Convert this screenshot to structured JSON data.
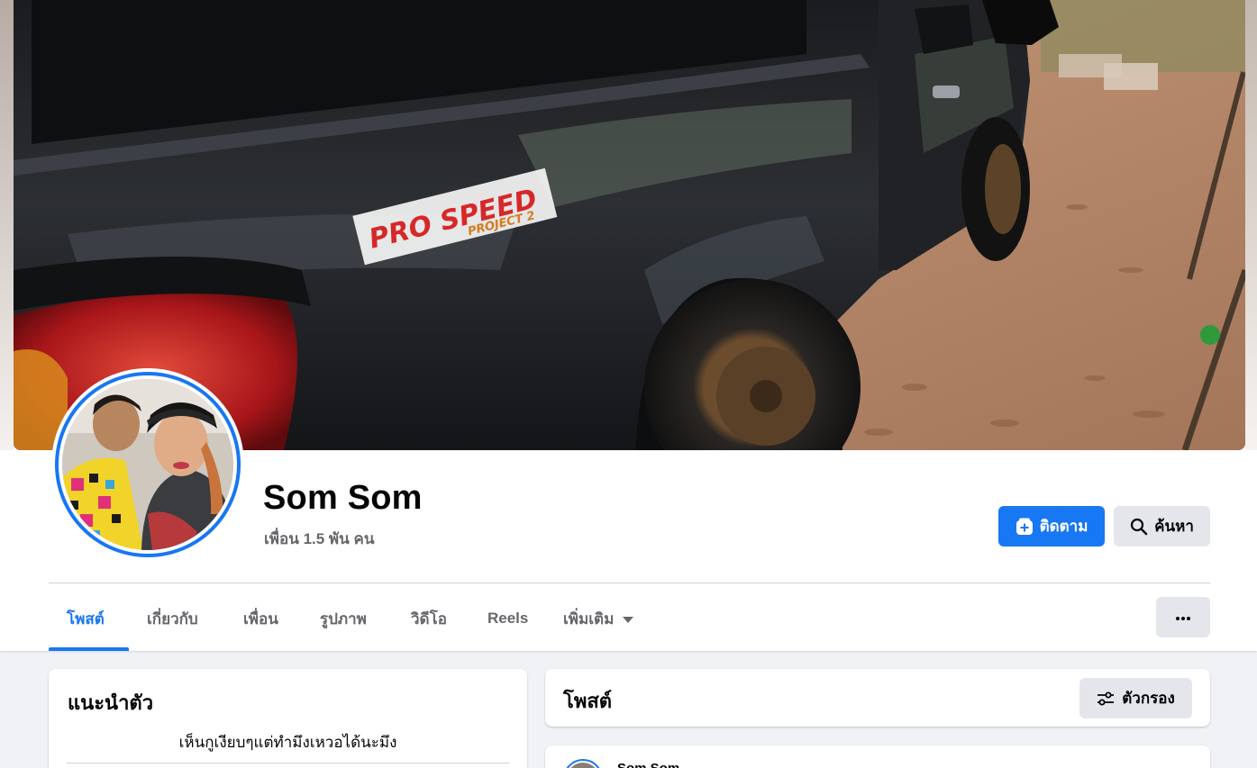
{
  "profile": {
    "name": "Som Som",
    "friends_text": "เพื่อน 1.5 พัน คน"
  },
  "cover": {
    "sticker_text": "PRO SPEED",
    "sticker_subtext": "PROJECT 2"
  },
  "actions": {
    "follow_label": "ติดตาม",
    "search_label": "ค้นหา"
  },
  "tabs": [
    {
      "label": "โพสต์",
      "active": true
    },
    {
      "label": "เกี่ยวกับ",
      "active": false
    },
    {
      "label": "เพื่อน",
      "active": false
    },
    {
      "label": "รูปภาพ",
      "active": false
    },
    {
      "label": "วิดีโอ",
      "active": false
    },
    {
      "label": "Reels",
      "active": false
    },
    {
      "label": "เพิ่มเติม",
      "active": false
    }
  ],
  "intro": {
    "title": "แนะนำตัว",
    "bio": "เห็นกูเงียบๆแต่ทำมึงเหวอได้นะมึง"
  },
  "posts": {
    "title": "โพสต์",
    "filter_label": "ตัวกรอง",
    "first_post_author": "Som Som"
  },
  "colors": {
    "accent": "#1877f2",
    "secondary_button": "#e4e6eb",
    "muted_text": "#65676b",
    "page_background": "#f0f2f5"
  },
  "icons": {
    "follow": "follow-plus-icon",
    "search": "search-icon",
    "more": "more-dots-icon",
    "filter": "filter-sliders-icon",
    "dropdown": "caret-down-icon"
  }
}
